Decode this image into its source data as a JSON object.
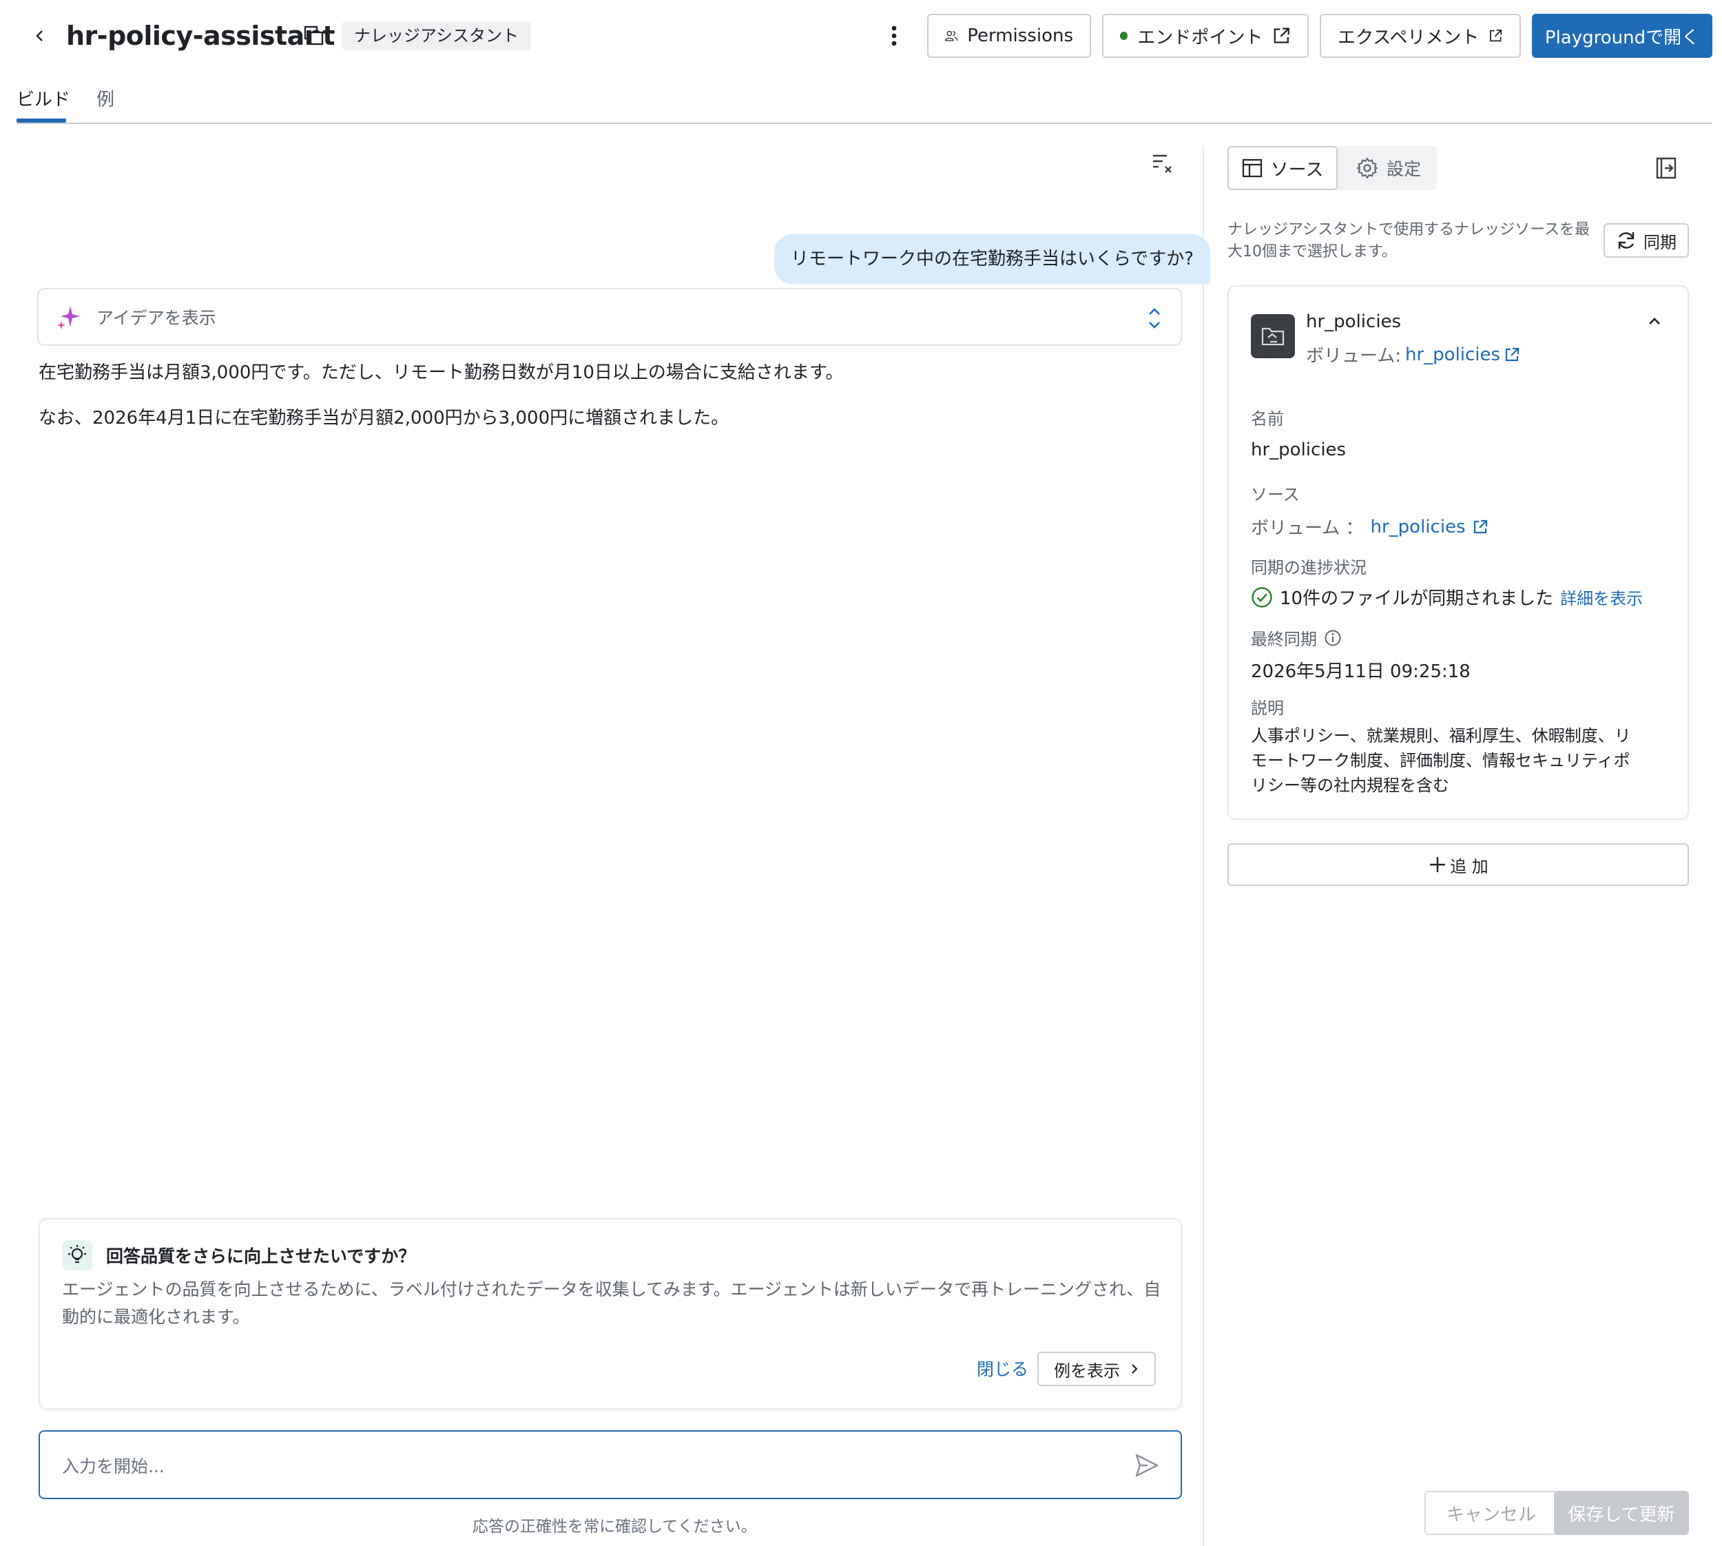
{
  "header": {
    "title": "hr-policy-assistant",
    "badge": "ナレッジアシスタント",
    "permissions_label": "Permissions",
    "endpoint_label": "エンドポイント",
    "experiment_label": "エクスペリメント",
    "playground_label": "Playgroundで開く"
  },
  "tabs": [
    {
      "label": "ビルド",
      "active": true
    },
    {
      "label": "例",
      "active": false
    }
  ],
  "chat": {
    "user_message": "リモートワーク中の在宅勤務手当はいくらですか?",
    "ideas_label": "アイデアを表示",
    "answer_lines": [
      "在宅勤務手当は月額3,000円です。ただし、リモート勤務日数が月10日以上の場合に支給されます。",
      "なお、2026年4月1日に在宅勤務手当が月額2,000円から3,000円に増額されました。"
    ],
    "suggestion": {
      "title": "回答品質をさらに向上させたいですか？",
      "body": "エージェントの品質を向上させるために、ラベル付けされたデータを収集してみます。エージェントは新しいデータで再トレーニングされ、自動的に最適化されます。",
      "close_label": "閉じる",
      "show_label": "例を表示"
    },
    "input_placeholder": "入力を開始...",
    "disclaimer": "応答の正確性を常に確認してください。"
  },
  "panel": {
    "seg_source": "ソース",
    "seg_settings": "設定",
    "description": "ナレッジアシスタントで使用するナレッジソースを最大10個まで選択します。",
    "sync_label": "同期",
    "source": {
      "name": "hr_policies",
      "volume_prefix": "ボリューム:",
      "volume_link": "hr_policies",
      "fields": {
        "name_label": "名前",
        "name_value": "hr_policies",
        "source_label": "ソース",
        "source_prefix": "ボリューム ：",
        "source_link": "hr_policies",
        "progress_label": "同期の進捗状況",
        "progress_value": "10件のファイルが同期されました",
        "progress_link": "詳細を表示",
        "last_sync_label": "最終同期",
        "last_sync_value": "2026年5月11日 09:25:18",
        "desc_label": "説明",
        "desc_value": "人事ポリシー、就業規則、福利厚生、休暇制度、リモートワーク制度、評価制度、情報セキュリティポリシー等の社内規程を含む"
      }
    },
    "add_label": "追 加",
    "cancel_label": "キャンセル",
    "save_label": "保存して更新"
  },
  "colors": {
    "accent": "#1f6bb5",
    "user_bubble": "#d9ecfb",
    "status_green": "#2e7d32"
  }
}
